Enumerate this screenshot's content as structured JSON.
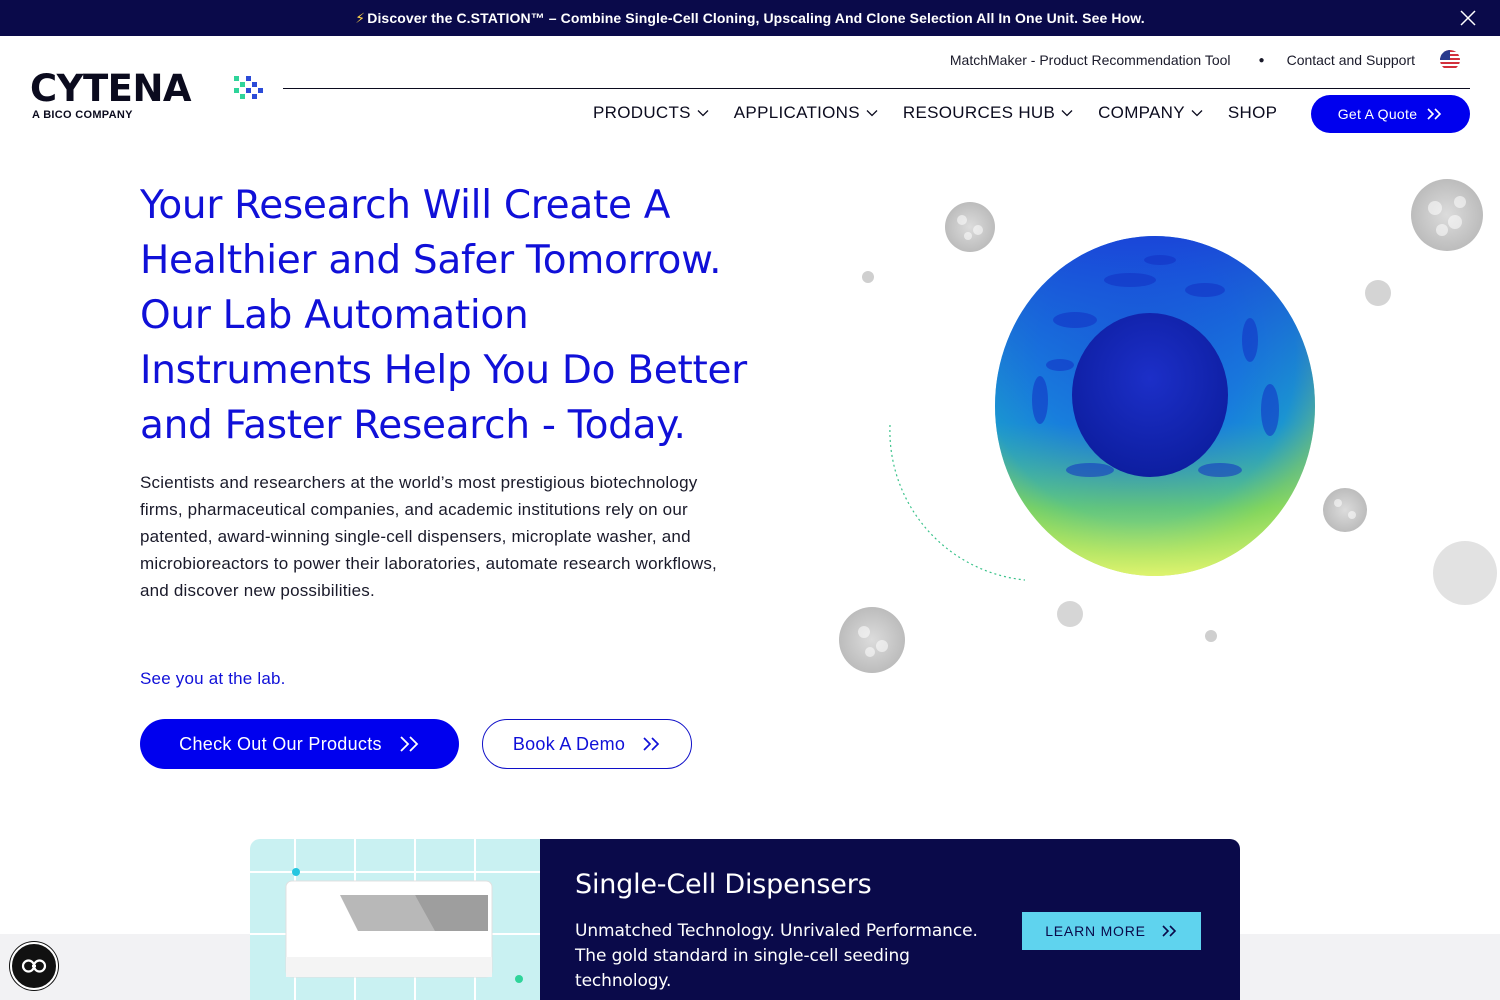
{
  "announcement": {
    "bolt": "⚡",
    "text": "Discover the C.STATION™ – Combine Single-Cell Cloning, Upscaling And Clone Selection All In One Unit. See How."
  },
  "header": {
    "logo_word": "CYTENA",
    "logo_sub": "A BICO COMPANY",
    "utility_links": [
      "MatchMaker - Product Recommendation Tool",
      "Contact and Support"
    ],
    "utility_separator": "●",
    "flag_icon": "us-flag-icon",
    "nav": [
      {
        "label": "PRODUCTS",
        "has_dropdown": true
      },
      {
        "label": "APPLICATIONS",
        "has_dropdown": true
      },
      {
        "label": "RESOURCES HUB",
        "has_dropdown": true
      },
      {
        "label": "COMPANY",
        "has_dropdown": true
      },
      {
        "label": "SHOP",
        "has_dropdown": false
      }
    ],
    "quote_button": "Get A Quote"
  },
  "hero": {
    "title": "Your Research Will Create A Healthier and Safer Tomorrow. Our Lab Automation Instruments Help You Do Better and Faster Research - Today.",
    "body": "Scientists and researchers at the world’s most prestigious biotechnology firms, pharmaceutical companies, and academic institutions rely on our patented, award-winning single-cell dispensers, microplate washer, and microbioreactors to power their laboratories, automate research workflows, and discover new possibilities.",
    "tagline": "See you at the lab.",
    "primary_button": "Check Out Our Products",
    "secondary_button": "Book A Demo"
  },
  "product_card": {
    "name": "Single-Cell Dispensers",
    "description": "Unmatched Technology. Unrivaled Performance. The gold standard in single-cell seeding technology.",
    "button": "LEARN MORE"
  },
  "colors": {
    "brand_blue": "#0000ee",
    "navy": "#0a0a4a",
    "accent_cyan": "#5fd3ee",
    "accent_green": "#2fd49a"
  }
}
